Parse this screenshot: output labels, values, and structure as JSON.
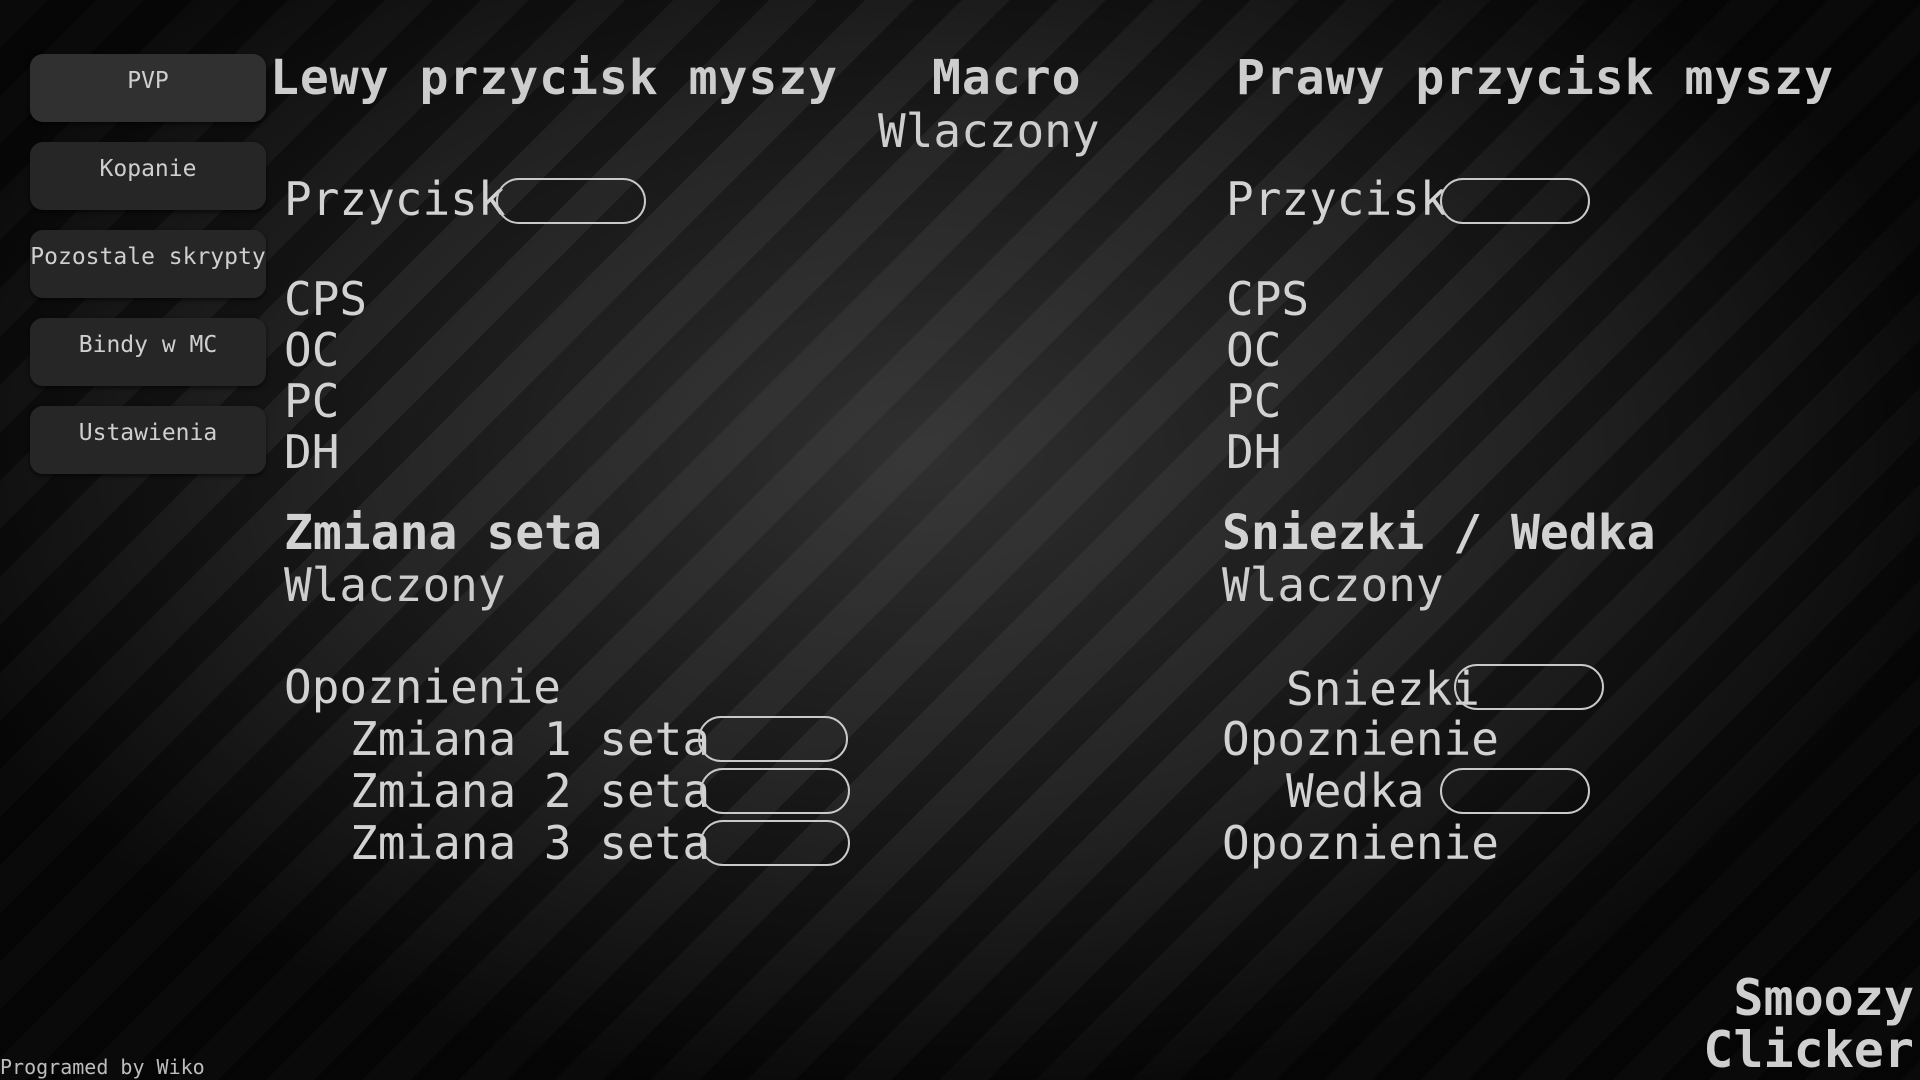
{
  "sidebar": {
    "items": [
      {
        "label": "PVP"
      },
      {
        "label": "Kopanie"
      },
      {
        "label": "Pozostale skrypty"
      },
      {
        "label": "Bindy w MC"
      },
      {
        "label": "Ustawienia"
      }
    ]
  },
  "left": {
    "header": "Lewy przycisk myszy",
    "button_label": "Przycisk",
    "button_value": "",
    "stats": [
      "CPS",
      "OC",
      "PC",
      "DH"
    ],
    "set_change": {
      "title": "Zmiana seta",
      "status": "Wlaczony",
      "delay_label": "Opoznienie",
      "rows": [
        {
          "label": "Zmiana 1 seta",
          "value": ""
        },
        {
          "label": "Zmiana 2 seta",
          "value": ""
        },
        {
          "label": "Zmiana 3 seta",
          "value": ""
        }
      ]
    }
  },
  "macro": {
    "title": "Macro",
    "status": "Wlaczony"
  },
  "right": {
    "header": "Prawy przycisk myszy",
    "button_label": "Przycisk",
    "button_value": "",
    "stats": [
      "CPS",
      "OC",
      "PC",
      "DH"
    ],
    "snowballs_rod": {
      "title": "Sniezki / Wedka",
      "status": "Wlaczony",
      "snowballs_label": "Sniezki",
      "snowballs_value": "",
      "snowballs_delay_label": "Opoznienie",
      "rod_label": "Wedka",
      "rod_value": "",
      "rod_delay_label": "Opoznienie"
    }
  },
  "footer": {
    "credit": "Programed by Wiko",
    "brand_line1": "Smoozy",
    "brand_line2": "Clicker"
  }
}
